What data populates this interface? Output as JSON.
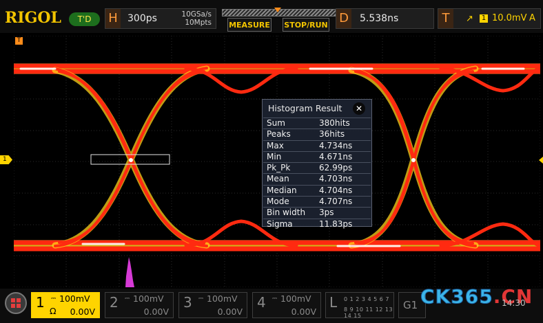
{
  "brand": {
    "logo": "RIGOL",
    "trigger_state": "T'D"
  },
  "horizontal": {
    "letter": "H",
    "timebase": "300ps",
    "sample_rate": "10GSa/s",
    "memory_depth": "10Mpts"
  },
  "buttons": {
    "measure": "MEASURE",
    "stop_run": "STOP/RUN"
  },
  "delay": {
    "letter": "D",
    "value": "5.538ns"
  },
  "trigger": {
    "letter": "T",
    "edge_symbol": "↗",
    "source": "1",
    "level": "10.0mV",
    "mode": "A"
  },
  "markers": {
    "trigger_position": "T",
    "ch1_ground": "1"
  },
  "histogram": {
    "title": "Histogram Result",
    "close": "✕",
    "rows": [
      {
        "label": "Sum",
        "value": "380hits"
      },
      {
        "label": "Peaks",
        "value": "36hits"
      },
      {
        "label": "Max",
        "value": "4.734ns"
      },
      {
        "label": "Min",
        "value": "4.671ns"
      },
      {
        "label": "Pk_Pk",
        "value": "62.99ps"
      },
      {
        "label": "Mean",
        "value": "4.703ns"
      },
      {
        "label": "Median",
        "value": "4.704ns"
      },
      {
        "label": "Mode",
        "value": "4.707ns"
      },
      {
        "label": "Bin width",
        "value": "3ps"
      },
      {
        "label": "Sigma",
        "value": "11.83ps"
      }
    ]
  },
  "channels": [
    {
      "num": "1",
      "coupling": "⎓",
      "scale": "100mV",
      "impedance": "Ω",
      "offset": "0.00V",
      "active": true
    },
    {
      "num": "2",
      "coupling": "⎓",
      "scale": "100mV",
      "impedance": "",
      "offset": "0.00V",
      "active": false
    },
    {
      "num": "3",
      "coupling": "⎓",
      "scale": "100mV",
      "impedance": "",
      "offset": "0.00V",
      "active": false
    },
    {
      "num": "4",
      "coupling": "⎓",
      "scale": "100mV",
      "impedance": "",
      "offset": "0.00V",
      "active": false
    }
  ],
  "logic_analyzer": {
    "label": "L",
    "digits_row1": "0 1 2 3  4 5 6 7",
    "digits_row2": "8 9 10 11 12 13 14 15"
  },
  "generator": {
    "label": "G1"
  },
  "clock": "14:30",
  "watermark": {
    "part1": "CK365",
    "part2": ".CN"
  },
  "colors": {
    "accent": "#f2c400",
    "orange": "#ff8c1a",
    "trace_red": "#ff2a10",
    "histogram": "#d63ad6"
  }
}
